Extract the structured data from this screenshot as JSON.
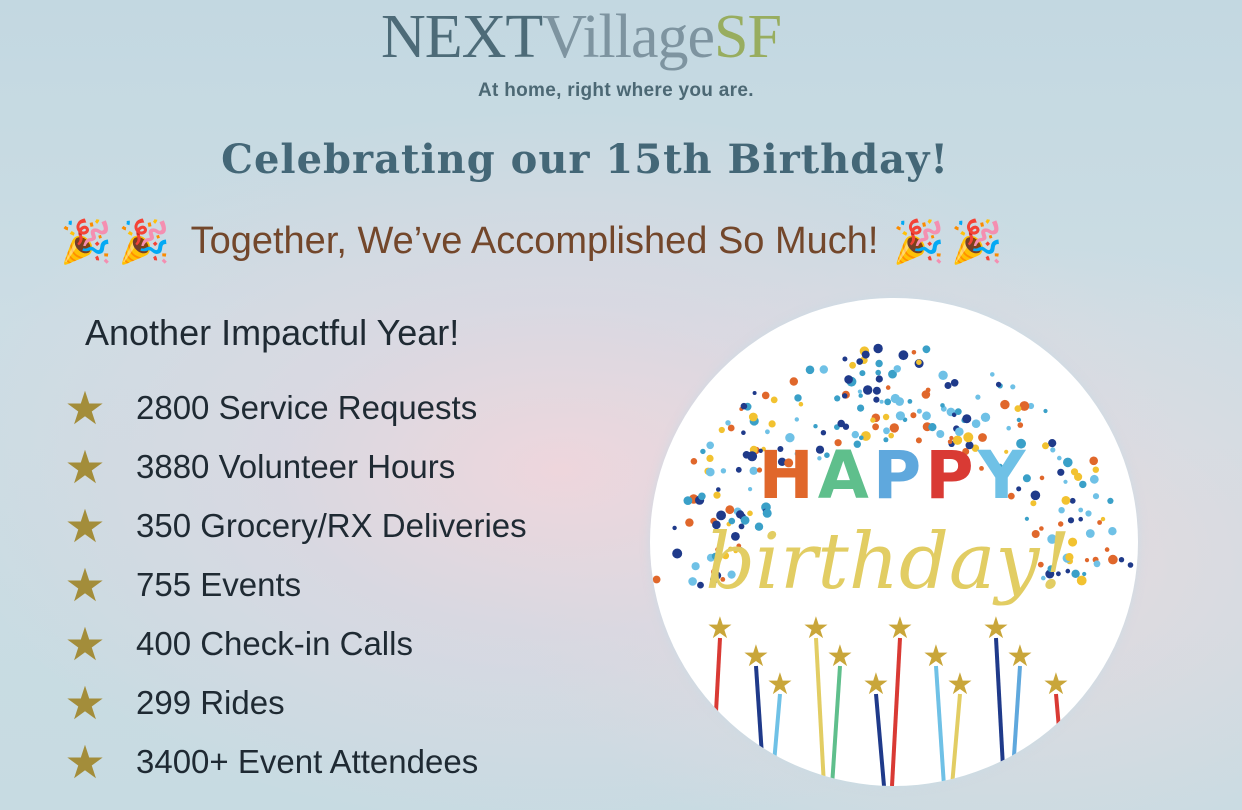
{
  "logo": {
    "next": "NEXT",
    "village": "Village",
    "sf": "SF"
  },
  "tagline": "At home, right where you are.",
  "headline": "Celebrating our 15th Birthday!",
  "subheadline": "Together, We’ve Accomplished So Much!",
  "section_title": "Another Impactful Year!",
  "stats": [
    {
      "icon": "star-icon",
      "label": "2800 Service Requests"
    },
    {
      "icon": "star-icon",
      "label": "3880 Volunteer Hours"
    },
    {
      "icon": "star-icon",
      "label": "350 Grocery/RX Deliveries"
    },
    {
      "icon": "star-icon",
      "label": "755 Events"
    },
    {
      "icon": "star-icon",
      "label": "400 Check-in Calls"
    },
    {
      "icon": "star-icon",
      "label": "299 Rides"
    },
    {
      "icon": "star-icon",
      "label": "3400+ Event Attendees"
    }
  ],
  "badge": {
    "line1": "HAPPY",
    "line2": "birthday!"
  },
  "colors": {
    "accent_blue": "#446777",
    "brown": "#73472b",
    "star_gold": "#a38d3a",
    "logo_green": "#98ad5f"
  }
}
